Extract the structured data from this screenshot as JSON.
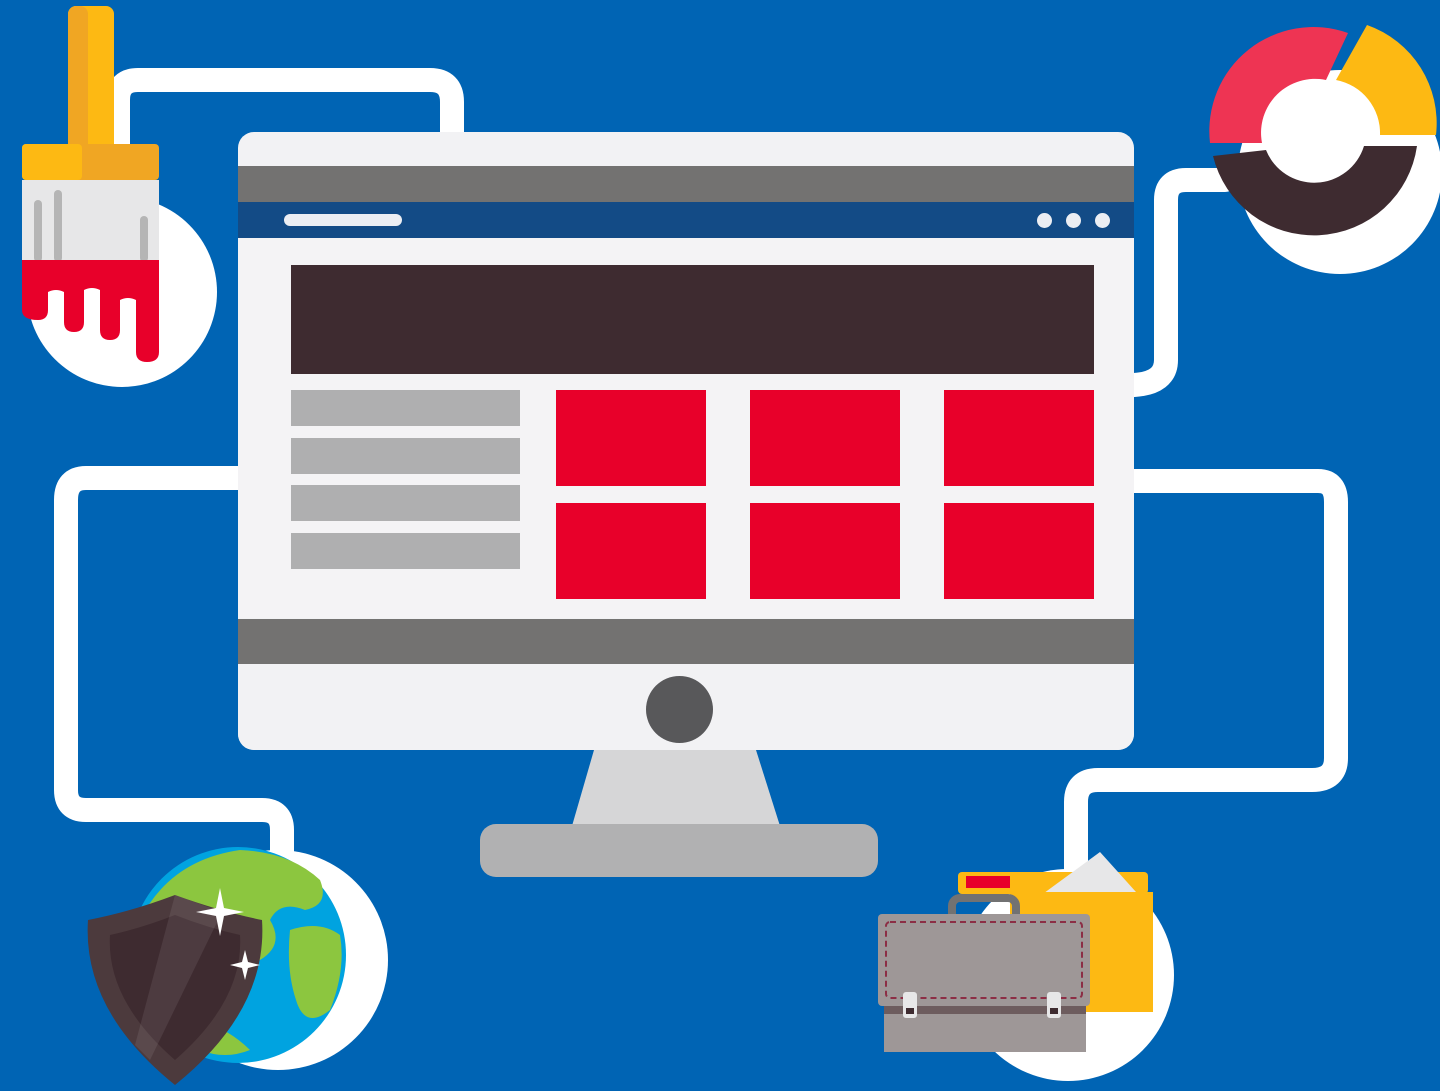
{
  "colors": {
    "background": "#0064B4",
    "screen": "#F2F2F4",
    "bar_gray": "#737271",
    "browser_bar": "#134B86",
    "hero": "#3E2B30",
    "sidebar_item": "#AFAFB0",
    "tile_red": "#E8002A",
    "connector": "#FFFFFF"
  },
  "icons": [
    "paint-brush-icon",
    "donut-chart-icon",
    "globe-icon",
    "shield-icon",
    "briefcase-icon",
    "folder-icon"
  ],
  "monitor": {
    "sidebar_items": 4,
    "tiles": 6,
    "browser_dots": 3
  }
}
